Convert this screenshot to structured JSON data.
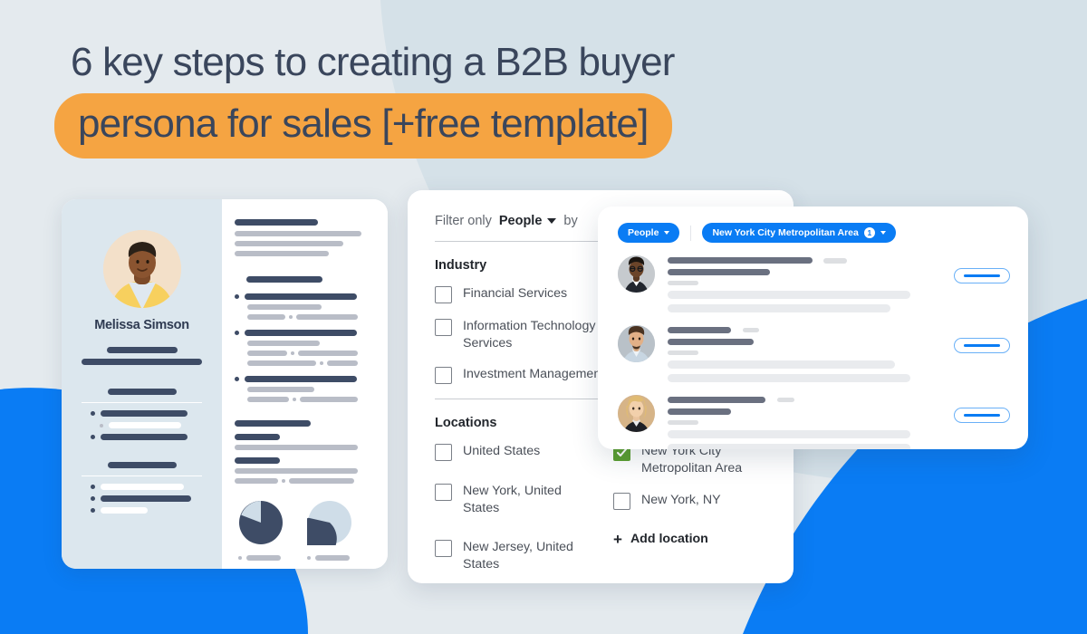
{
  "background": {
    "base_color": "#e4eaee",
    "panel_color": "#d5e1e8",
    "accent_blue": "#0a7cf4"
  },
  "headline": {
    "line1": "6 key steps to creating a B2B buyer",
    "line2": "persona for sales [+free template]",
    "text_color": "#3a465c",
    "highlight_color": "#f5a442"
  },
  "persona_card": {
    "name": "Melissa Simson",
    "avatar_icon": "person-photo",
    "chart1_icon": "pie-chart",
    "chart2_icon": "pie-chart"
  },
  "filter_panel": {
    "header": {
      "prefix": "Filter only",
      "entity": "People",
      "suffix": "by",
      "caret_icon": "chevron-down-icon"
    },
    "industry": {
      "title": "Industry",
      "options": [
        {
          "label": "Financial Services",
          "checked": false
        },
        {
          "label": "Information Technology & Services",
          "checked": false
        },
        {
          "label": "Investment Management",
          "checked": false
        }
      ]
    },
    "locations": {
      "title": "Locations",
      "column_left": [
        {
          "label": "United States",
          "checked": false
        },
        {
          "label": "New York, United States",
          "checked": false
        },
        {
          "label": "New Jersey, United States",
          "checked": false
        }
      ],
      "column_right": [
        {
          "label": "New York City Metropolitan Area",
          "checked": true
        },
        {
          "label": "New York, NY",
          "checked": false
        }
      ],
      "add_location": "Add location",
      "add_icon": "plus-icon",
      "checked_color": "#5a9e2f"
    }
  },
  "results_panel": {
    "pills": [
      {
        "label": "People",
        "count": "",
        "caret_icon": "chevron-down-icon"
      },
      {
        "label": "New York City Metropolitan Area",
        "count": "1",
        "caret_icon": "chevron-down-icon"
      }
    ],
    "rows": [
      {
        "avatar_icon": "person-photo"
      },
      {
        "avatar_icon": "person-photo"
      },
      {
        "avatar_icon": "person-photo"
      }
    ],
    "action_icon": "connect-button"
  }
}
